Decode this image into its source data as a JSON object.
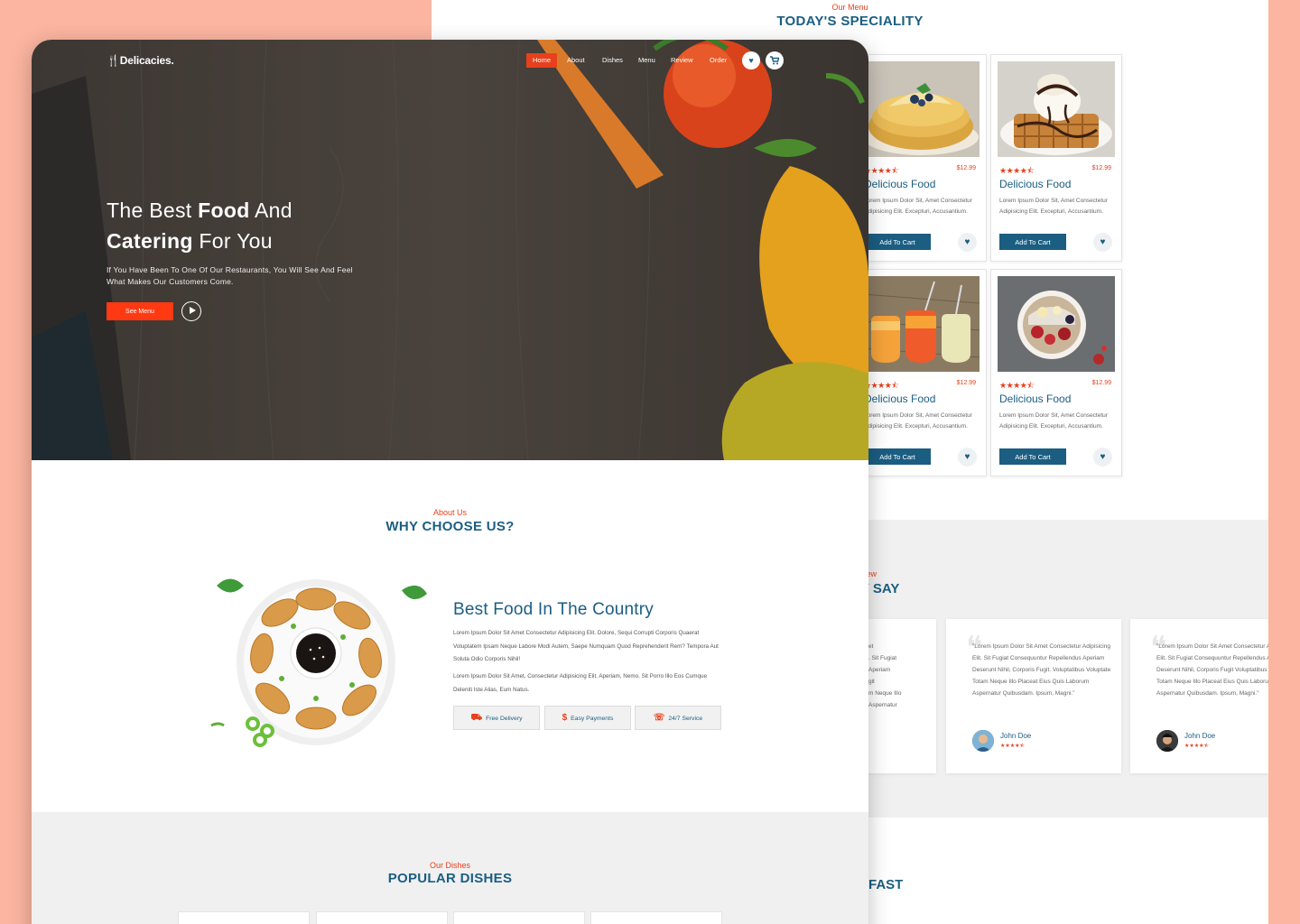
{
  "speciality": {
    "subtitle": "Our Menu",
    "title": "TODAY'S SPECIALITY",
    "cards": [
      {
        "stars": "★★★★⯪",
        "price": "$12.99",
        "title": "Delicious Food",
        "desc": "Lorem Ipsum Dolor Sit, Amet Consectetur Adipisicing Elit. Excepturi, Accusantium.",
        "button": "Add To Cart",
        "heart": "♥",
        "photo": "pancakes"
      },
      {
        "stars": "★★★★⯪",
        "price": "$12.99",
        "title": "Delicious Food",
        "desc": "Lorem Ipsum Dolor Sit, Amet Consectetur Adipisicing Elit. Excepturi, Accusantium.",
        "button": "Add To Cart",
        "heart": "♥",
        "photo": "waffle-icecream"
      },
      {
        "stars": "★★★★⯪",
        "price": "$12.99",
        "title": "Delicious Food",
        "desc": "Lorem Ipsum Dolor Sit, Amet Consectetur Adipisicing Elit. Excepturi, Accusantium.",
        "button": "Add To Cart",
        "heart": "♥",
        "photo": "juices"
      },
      {
        "stars": "★★★★⯪",
        "price": "$12.99",
        "title": "Delicious Food",
        "desc": "Lorem Ipsum Dolor Sit, Amet Consectetur Adipisicing Elit. Excepturi, Accusantium.",
        "button": "Add To Cart",
        "heart": "♥",
        "photo": "fruit-bowl"
      }
    ]
  },
  "reviews": {
    "subtitle_visible": "view",
    "title_visible": "Y SAY",
    "cards": [
      {
        "text": "et\n. Sit Fugiat\n Aperiam\ngit\nm Neque Illo\n Aspernatur",
        "name": "",
        "stars": ""
      },
      {
        "text": "\"Lorem Ipsum Dolor Sit Amet Consectetur Adipisicing Elit. Sit Fugiat Consequuntur Repellendus Aperiam Deserunt Nihil, Corporis Fugit. Voluptatibus Voluptate Totam Neque Illo Placeat Eius Quis Laborum Aspernatur Quibusdam. Ipsum, Magni.\"",
        "name": "John Doe",
        "stars": "★★★★⯪"
      },
      {
        "text": "\"Lorem Ipsum Dolor Sit Amet Consectetur Adipisicing Elit. Sit Fugiat Consequuntur Repellendus Aperiam Deserunt Nihil, Corporis Fugit Voluptatibus Voluptate Totam Neque Illo Placeat Eius Quis Laborum Aspernatur Quibusdam. Ipsum, Magni.\"",
        "name": "John Doe",
        "stars": "★★★★⯪"
      }
    ]
  },
  "fast_title_visible": "FAST",
  "nav": {
    "logo": "Delicacies.",
    "logo_icon": "fork-knife-icon",
    "items": [
      "Home",
      "About",
      "Dishes",
      "Menu",
      "Review",
      "Order"
    ],
    "active": "Home",
    "heart_icon": "♥",
    "cart_icon": "🛒"
  },
  "hero": {
    "line1_prefix": "The Best ",
    "line1_bold": "Food",
    "line1_suffix": " And",
    "line2_bold": "Catering",
    "line2_suffix": " For You",
    "paragraph": "If You Have Been To One Of Our Restaurants, You Will See And Feel What Makes Our Customers Come.",
    "button": "See Menu"
  },
  "about": {
    "subtitle": "About Us",
    "title": "WHY CHOOSE US?",
    "heading": "Best Food In The Country",
    "para1": "Lorem Ipsum Dolor Sit Amet Consectetur Adipisicing Elit. Dolore, Sequi Corrupti Corporis Quaerat Voluptatem Ipsam Neque Labore Modi Autem, Saepe Numquam Quod Reprehenderit Rem? Tempora Aut Soluta Odio Corporis Nihil!",
    "para2": "Lorem Ipsum Dolor Sit Amet, Consectetur Adipisicing Elit. Aperiam, Nemo. Sit Porro Illo Eos Cumque Deleniti Iste Alias, Eum Natus.",
    "features": [
      {
        "icon": "truck-icon",
        "glyph": "🚚",
        "label": "Free Delivery"
      },
      {
        "icon": "dollar-icon",
        "glyph": "$",
        "label": "Easy Payments"
      },
      {
        "icon": "headset-icon",
        "glyph": "☏",
        "label": "24/7 Service"
      }
    ]
  },
  "dishes": {
    "subtitle": "Our Dishes",
    "title": "POPULAR DISHES"
  },
  "colors": {
    "accent": "#e8401c",
    "primary": "#1b5e82",
    "background": "#fbb5a0"
  }
}
